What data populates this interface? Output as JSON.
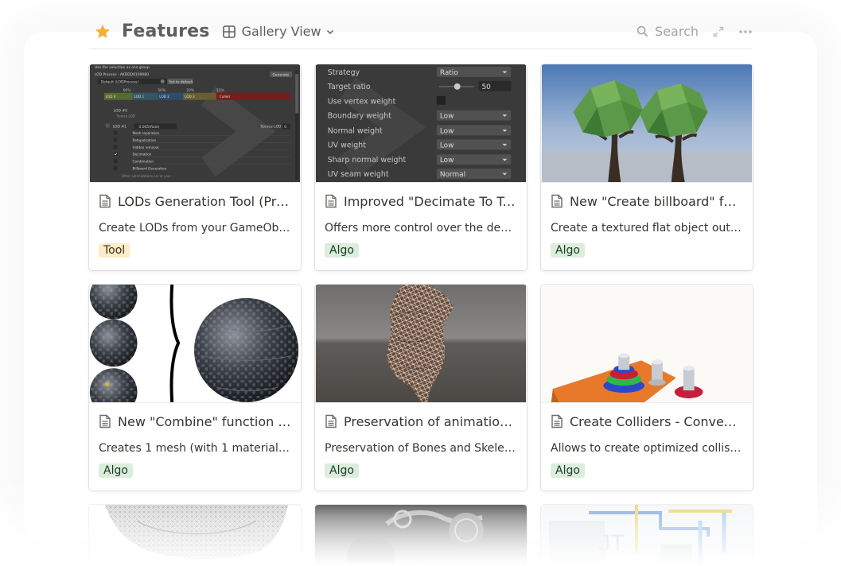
{
  "header": {
    "title": "Features",
    "view_label": "Gallery View",
    "search_label": "Search"
  },
  "colors": {
    "star": "#f2b134",
    "algo_tag_bg": "#dbeddb",
    "tool_tag_bg": "#fdecc8"
  },
  "cards": [
    {
      "title": "LODs Generation Tool (Previ...",
      "desc": "Create LODs from your GameObjects ...",
      "tag": "Tool"
    },
    {
      "title": "Improved \"Decimate To Targ...",
      "desc": "Offers more control over the decimat...",
      "tag": "Algo"
    },
    {
      "title": "New \"Create billboard\" func...",
      "desc": "Create a textured flat object out of a ...",
      "tag": "Algo"
    },
    {
      "title": "New \"Combine\" function in ...",
      "desc": "Creates 1 mesh (with 1 material + tex...",
      "tag": "Algo"
    },
    {
      "title": "Preservation of animations ...",
      "desc": "Preservation of Bones and Skeleton o...",
      "tag": "Algo"
    },
    {
      "title": "Create Colliders - Convex d...",
      "desc": "Allows to create optimized collision ...",
      "tag": "Algo"
    }
  ],
  "thumb1": {
    "header_line": "Use the selection as one group",
    "process_label": "LOD Process - AKDDD0109080",
    "generate_label": "Generate",
    "default_label": "Default (LODProcess)",
    "set_default_label": "Set to default",
    "percent_labels": [
      "60%",
      "50%",
      "20%",
      "11%"
    ],
    "lod_bars": [
      "LOD 0",
      "LOD 1",
      "LOD 2",
      "LOD 3",
      "Culled"
    ],
    "lod_label": "LOD #0",
    "source_label": "Source LOD",
    "lod1_label": "LOD #1",
    "lod1_value": "0.005(Rule)",
    "source_lod_label": "Source LOD",
    "source_lod_value": "0",
    "steps": [
      "Mesh reparation",
      "Retopolization",
      "Hidden removal",
      "Decimation",
      "Combination",
      "Billboard Generation"
    ],
    "footer": "Other optimizations are at your..."
  },
  "thumb2": {
    "rows": [
      {
        "label": "Strategy",
        "value": "Ratio"
      },
      {
        "label": "Target ratio",
        "value": "50"
      },
      {
        "label": "Use vertex weight",
        "value": ""
      },
      {
        "label": "Boundary weight",
        "value": "Low"
      },
      {
        "label": "Normal weight",
        "value": "Low"
      },
      {
        "label": "UV weight",
        "value": "Low"
      },
      {
        "label": "Sharp normal weight",
        "value": "Low"
      },
      {
        "label": "UV seam weight",
        "value": "Normal"
      }
    ]
  },
  "partial_cards": [
    {
      "thumb": "mesh-torso-thumbnail",
      "text": ""
    },
    {
      "thumb": "engine-render-thumbnail",
      "text": ""
    },
    {
      "thumb": "jt-scene-thumbnail",
      "text": "JT"
    }
  ]
}
